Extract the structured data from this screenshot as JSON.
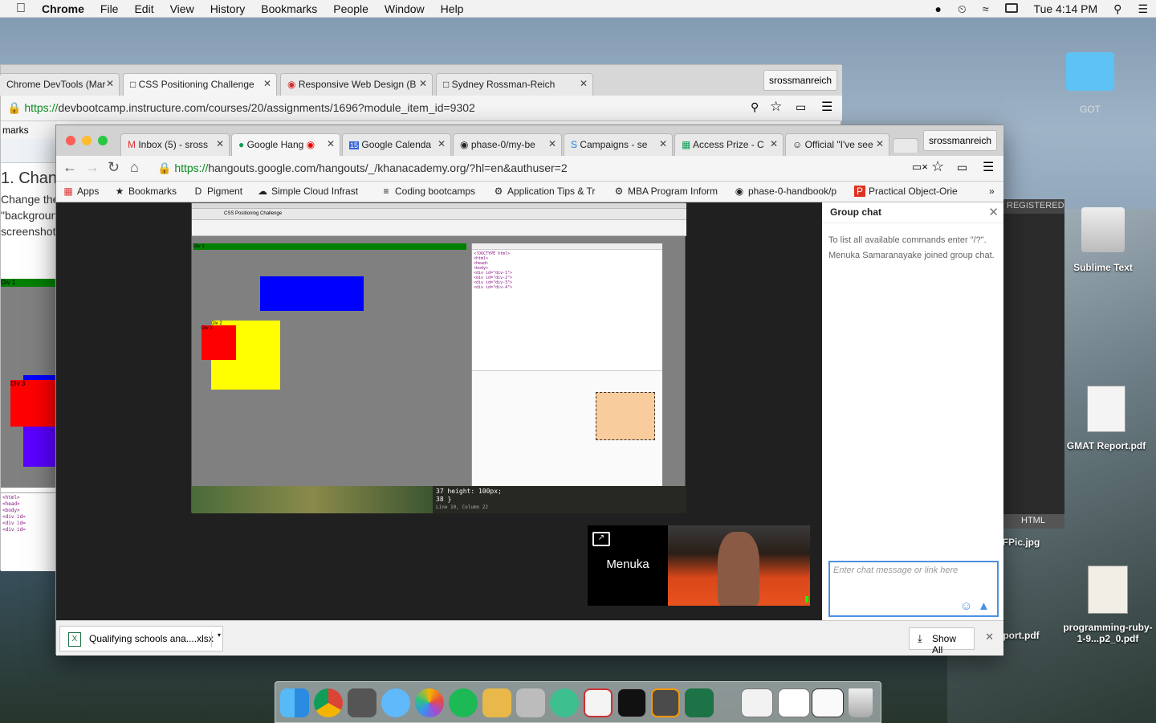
{
  "menubar": {
    "app": "Chrome",
    "items": [
      "File",
      "Edit",
      "View",
      "History",
      "Bookmarks",
      "People",
      "Window",
      "Help"
    ],
    "clock": "Tue 4:14 PM"
  },
  "back_window": {
    "tabs": [
      "Chrome DevTools (Mar",
      "CSS Positioning Challenge",
      "Responsive Web Design (B",
      "Sydney Rossman-Reich"
    ],
    "profile": "srossmanreich",
    "url_scheme": "https://",
    "url_rest": "devbootcamp.instructure.com/courses/20/assignments/1696?module_item_id=9302",
    "bookmarks_fragment": "marks",
    "content": {
      "heading": "1. Chang",
      "line1": "Change the",
      "line2": "\"backgroun",
      "line3": "screenshot",
      "div1": "Div 1",
      "div3": "Div 3"
    }
  },
  "front_window": {
    "tabs": [
      "Inbox (5) - sross",
      "Google Hang",
      "Google Calenda",
      "phase-0/my-be",
      "Campaigns - se",
      "Access Prize - C",
      "Official \"I've see"
    ],
    "profile": "srossmanreich",
    "url_scheme": "https://",
    "url_rest": "hangouts.google.com/hangouts/_/khanacademy.org/?hl=en&authuser=2",
    "bookmarks": [
      "Apps",
      "Bookmarks",
      "Pigment",
      "Simple Cloud Infrast",
      "Coding bootcamps",
      "Application Tips & Tr",
      "MBA Program Inform",
      "phase-0-handbook/p",
      "Practical Object-Orie"
    ],
    "shared_screen": {
      "window_title": "CSS Positioning Challenge",
      "div1_label": "Div 1",
      "div2_label": "Div 2",
      "div4_label": "Div 3",
      "editor_line": "37    height: 100px;",
      "editor_line2": "38  }",
      "status": "Line 10, Column 22"
    },
    "chat": {
      "title": "Group chat",
      "msg1": "To list all available commands enter \"/?\".",
      "msg2": "Menuka Samaranayake joined group chat.",
      "placeholder": "Enter chat message or link here"
    },
    "video": {
      "participant": "Menuka"
    },
    "download": {
      "file": "Qualifying schools ana....xlsx",
      "show_all": "Show All"
    }
  },
  "desktop_icons": {
    "got": "GOT",
    "sublime": "Sublime Text",
    "gmat": "GMAT Report.pdf",
    "html": "HTML",
    "pic": "FPic.jpg",
    "report": "port.pdf",
    "ruby": "programming-ruby-1-9...p2_0.pdf",
    "registered": "REGISTERED"
  },
  "colors": {
    "div_blue": "#0000ff",
    "div_yellow": "#ffff00",
    "div_red": "#ff0000",
    "div_green": "#008000",
    "chat_border": "#4a90e2"
  }
}
